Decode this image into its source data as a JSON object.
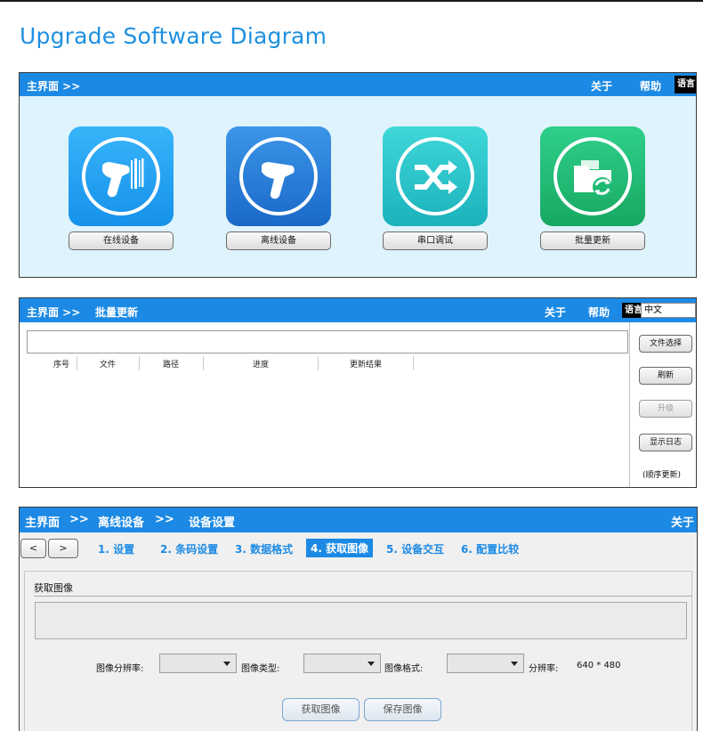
{
  "page_title": "Upgrade Software Diagram",
  "panel1": {
    "breadcrumb": "主界面 >>",
    "menu": {
      "about": "关于",
      "help": "帮助",
      "language": "语言"
    },
    "tiles": [
      {
        "label": "在线设备",
        "icon": "scanner-barcode-icon",
        "color": "#1e9bf0"
      },
      {
        "label": "离线设备",
        "icon": "scanner-icon",
        "color": "#1e7fd8"
      },
      {
        "label": "串口调试",
        "icon": "shuffle-icon",
        "color": "#21c2c9"
      },
      {
        "label": "批量更新",
        "icon": "folder-refresh-icon",
        "color": "#1fba74"
      }
    ]
  },
  "panel2": {
    "breadcrumb": "主界面 >>",
    "current": "批量更新",
    "menu": {
      "about": "关于",
      "help": "帮助",
      "language": "语言",
      "language_value": "中文"
    },
    "columns": [
      "序号",
      "文件",
      "路径",
      "进度",
      "更新结果"
    ],
    "buttons": {
      "file_select": "文件选择",
      "refresh": "刷新",
      "upgrade": "升级",
      "show_log": "显示日志"
    },
    "note": "(顺序更新)"
  },
  "panel3": {
    "breadcrumb": {
      "root": "主界面",
      "sep1": ">>",
      "offline": "离线设备",
      "sep2": ">>",
      "settings": "设备设置"
    },
    "menu": {
      "about": "关于"
    },
    "nav": {
      "prev": "<",
      "next": ">"
    },
    "steps": [
      "1. 设置",
      "2. 条码设置",
      "3. 数据格式",
      "4. 获取图像",
      "5. 设备交互",
      "6. 配置比较"
    ],
    "active_step": "4. 获取图像",
    "section_label": "获取图像",
    "fields": {
      "resolution_label": "图像分辨率:",
      "type_label": "图像类型:",
      "format_label": "图像格式:",
      "ratio_label": "分辨率:",
      "ratio_value": "640 * 480"
    },
    "buttons": {
      "capture": "获取图像",
      "save": "保存图像"
    }
  }
}
